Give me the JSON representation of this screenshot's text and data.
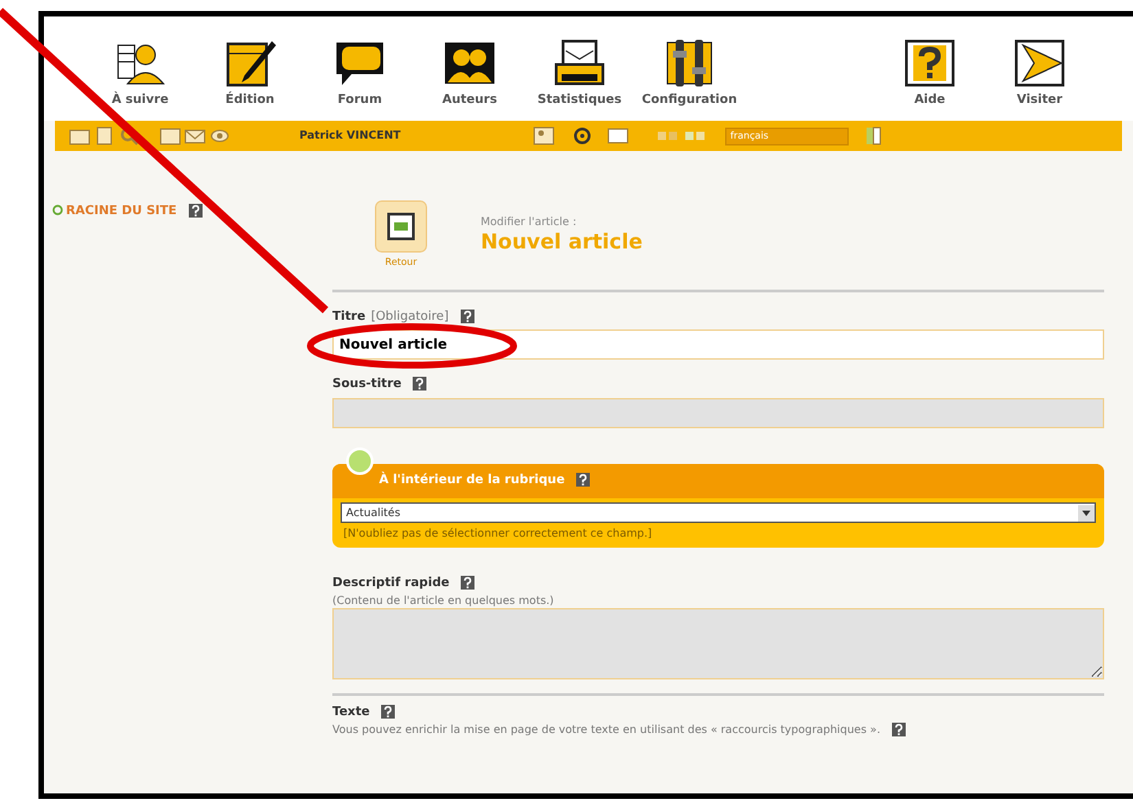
{
  "toolbar": [
    {
      "label": "À suivre",
      "kind": "follow"
    },
    {
      "label": "Édition",
      "kind": "edit"
    },
    {
      "label": "Forum",
      "kind": "forum"
    },
    {
      "label": "Auteurs",
      "kind": "authors"
    },
    {
      "label": "Statistiques",
      "kind": "stats"
    },
    {
      "label": "Configuration",
      "kind": "config"
    },
    {
      "label": "Aide",
      "kind": "help"
    },
    {
      "label": "Visiter",
      "kind": "visit"
    }
  ],
  "user_bar": {
    "user": "Patrick VINCENT",
    "language": "français"
  },
  "sidebar": {
    "root_link": "RACINE DU SITE"
  },
  "header": {
    "back_button": "Retour",
    "subtitle": "Modifier l'article :",
    "title": "Nouvel article"
  },
  "fields": [
    {
      "kind": "text",
      "label": "Titre",
      "note": "[Obligatoire]",
      "value": "Nouvel article"
    },
    {
      "kind": "text",
      "label": "Sous-titre"
    }
  ],
  "section": {
    "title": "À l'intérieur de la rubrique",
    "select": "Actualités",
    "warning": "[N'oubliez pas de sélectionner correctement ce champ.]"
  },
  "description": {
    "label": "Descriptif rapide",
    "hint": "(Contenu de l'article en quelques mots.)"
  },
  "text_field": {
    "label": "Texte",
    "hint": "Vous pouvez enrichir la mise en page de votre texte en utilisant des « raccourcis typographiques »."
  }
}
